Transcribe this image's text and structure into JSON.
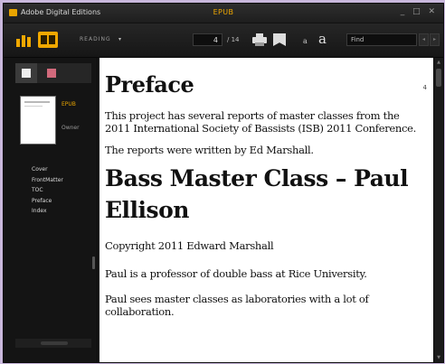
{
  "titlebar": {
    "app_title": "Adobe Digital Editions",
    "doc_title": "EPUB",
    "controls": "_ □ ✕"
  },
  "toolbar": {
    "mode_label": "READING",
    "mode_caret": "▾",
    "current_page": "4",
    "page_total": "/ 14",
    "font_small": "a",
    "font_large": "a",
    "search_placeholder": "Find",
    "prev": "◂",
    "next": "▸"
  },
  "sidebar": {
    "book_type": "EPUB",
    "owner": "Owner",
    "toc": [
      {
        "label": "Cover"
      },
      {
        "label": "FrontMatter"
      },
      {
        "label": "TOC"
      },
      {
        "label": "Preface"
      },
      {
        "label": "Index"
      }
    ]
  },
  "page": {
    "page_number": "4",
    "heading1": "Preface",
    "para1": "This project has several reports of master classes from the 2011 International Society of Bassists (ISB) 2011 Conference.",
    "para2": "The reports were written by Ed Marshall.",
    "heading2": "Bass Master Class – Paul Ellison",
    "para3": "Copyright 2011 Edward Marshall",
    "para4": "Paul is a professor of double bass at Rice University.",
    "para5": "Paul sees master classes as laboratories with a lot of collaboration."
  },
  "colors": {
    "accent": "#f0a800",
    "bookmark": "#d26a7c",
    "background": "#1b1b1b",
    "page": "#ffffff"
  }
}
